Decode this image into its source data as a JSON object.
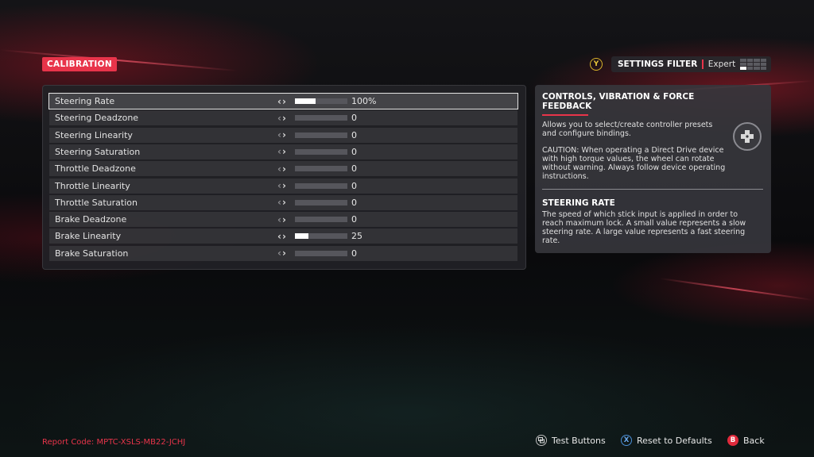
{
  "header": {
    "section_badge": "CALIBRATION",
    "filter_button_glyph": "Y",
    "filter_title": "SETTINGS FILTER",
    "filter_value": "Expert"
  },
  "settings": [
    {
      "label": "Steering Rate",
      "value": "100%",
      "fill": 0.4,
      "selected": true
    },
    {
      "label": "Steering Deadzone",
      "value": "0",
      "fill": 0
    },
    {
      "label": "Steering Linearity",
      "value": "0",
      "fill": 0
    },
    {
      "label": "Steering Saturation",
      "value": "0",
      "fill": 0
    },
    {
      "label": "Throttle Deadzone",
      "value": "0",
      "fill": 0
    },
    {
      "label": "Throttle Linearity",
      "value": "0",
      "fill": 0
    },
    {
      "label": "Throttle Saturation",
      "value": "0",
      "fill": 0
    },
    {
      "label": "Brake Deadzone",
      "value": "0",
      "fill": 0
    },
    {
      "label": "Brake Linearity",
      "value": "25",
      "fill": 0.25
    },
    {
      "label": "Brake Saturation",
      "value": "0",
      "fill": 0
    }
  ],
  "info": {
    "title": "CONTROLS, VIBRATION & FORCE FEEDBACK",
    "desc": "Allows you to select/create controller presets and configure bindings.",
    "caution": "CAUTION: When operating a Direct Drive device with high torque values, the wheel can rotate without warning. Always follow device operating instructions.",
    "sub_title": "STEERING RATE",
    "sub_desc": "The speed of which stick input is applied in order to reach maximum lock. A small value represents a slow steering rate. A large value represents a fast steering rate."
  },
  "footer": {
    "report_code": "Report Code: MPTC-XSLS-MB22-JCHJ",
    "test_buttons": "Test Buttons",
    "reset_glyph": "X",
    "reset_defaults": "Reset to Defaults",
    "back_glyph": "B",
    "back": "Back"
  },
  "colors": {
    "accent": "#e8344a",
    "y_button": "#d9b42a",
    "x_button": "#4a8fd8",
    "b_button": "#e02a3c"
  },
  "icons": [
    "y-button-icon",
    "settings-filter-grid-icon",
    "dpad-icon",
    "view-button-icon",
    "x-button-icon",
    "b-button-icon",
    "chevron-left-icon",
    "chevron-right-icon"
  ]
}
